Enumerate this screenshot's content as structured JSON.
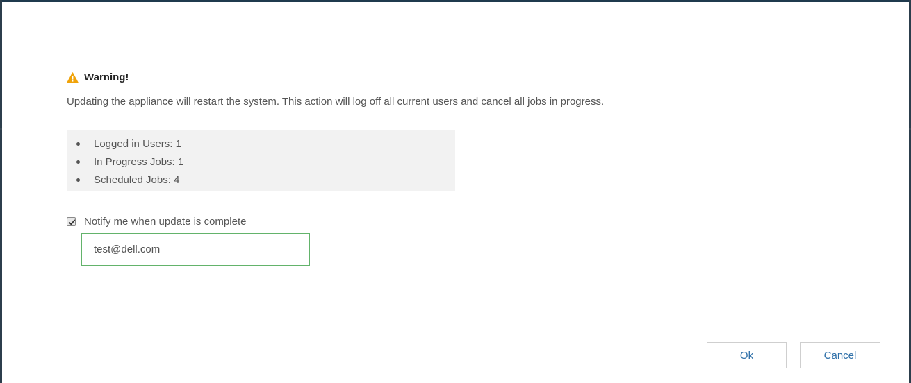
{
  "warning": {
    "title": "Warning!",
    "message": "Updating the appliance will restart the system. This action will log off all current users and cancel all jobs in progress."
  },
  "summary": {
    "items": [
      {
        "label": "Logged in Users: 1"
      },
      {
        "label": "In Progress Jobs: 1"
      },
      {
        "label": "Scheduled Jobs: 4"
      }
    ]
  },
  "notify": {
    "label": "Notify me when update is complete",
    "checked": true,
    "email_value": "test@dell.com"
  },
  "buttons": {
    "ok_label": "Ok",
    "cancel_label": "Cancel"
  },
  "colors": {
    "warning_icon": "#f0a30a",
    "input_border_valid": "#63b36b",
    "button_text": "#2d6fa8",
    "frame": "#1f3a4d"
  },
  "icons": {
    "warning": "warning-triangle-icon",
    "checkbox": "checkmark-icon"
  }
}
